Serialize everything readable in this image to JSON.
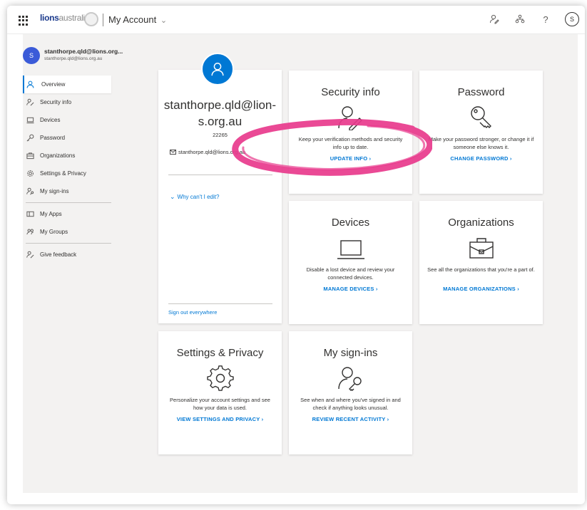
{
  "header": {
    "brand": "lions",
    "brand_suffix": "australia",
    "app_title": "My Account",
    "chevron": "⌄",
    "icons": [
      "feedback-icon",
      "org-chart-icon",
      "help-icon"
    ],
    "help_glyph": "?",
    "avatar_initial": "S"
  },
  "user": {
    "initial": "S",
    "name": "stanthorpe.qld@lions.org...",
    "email": "stanthorpe.qld@lions.org.au"
  },
  "nav": {
    "items": [
      {
        "label": "Overview",
        "icon": "person-icon",
        "active": true
      },
      {
        "label": "Security info",
        "icon": "security-info-icon"
      },
      {
        "label": "Devices",
        "icon": "laptop-icon"
      },
      {
        "label": "Password",
        "icon": "key-icon"
      },
      {
        "label": "Organizations",
        "icon": "briefcase-icon"
      },
      {
        "label": "Settings & Privacy",
        "icon": "gear-icon"
      },
      {
        "label": "My sign-ins",
        "icon": "sign-ins-icon"
      },
      {
        "label": "My Apps",
        "icon": "apps-icon"
      },
      {
        "label": "My Groups",
        "icon": "groups-icon"
      },
      {
        "label": "Give feedback",
        "icon": "feedback-icon"
      }
    ]
  },
  "profile": {
    "name_line1": "stanthorpe.qld@lion-",
    "name_line2": "s.org.au",
    "id": "22265",
    "email": "stanthorpe.qld@lions.org.au",
    "why_cant_edit": "Why can't I edit?",
    "sign_out": "Sign out everywhere"
  },
  "tiles": {
    "security": {
      "title": "Security info",
      "desc": "Keep your verification methods and security info up to date.",
      "action": "UPDATE INFO"
    },
    "password": {
      "title": "Password",
      "desc": "Make your password stronger, or change it if someone else knows it.",
      "action": "CHANGE PASSWORD"
    },
    "devices": {
      "title": "Devices",
      "desc": "Disable a lost device and review your connected devices.",
      "action": "MANAGE DEVICES"
    },
    "organizations": {
      "title": "Organizations",
      "desc": "See all the organizations that you're a part of.",
      "action": "MANAGE ORGANIZATIONS"
    },
    "settings": {
      "title": "Settings & Privacy",
      "desc": "Personalize your account settings and see how your data is used.",
      "action": "VIEW SETTINGS AND PRIVACY"
    },
    "signins": {
      "title": "My sign-ins",
      "desc": "See when and where you've signed in and check if anything looks unusual.",
      "action": "REVIEW RECENT ACTIVITY"
    }
  },
  "action_chevron": "›",
  "colors": {
    "accent": "#0078d4",
    "annotation": "#e8398c",
    "avatar": "#3b5bd8",
    "background": "#f3f2f1"
  }
}
